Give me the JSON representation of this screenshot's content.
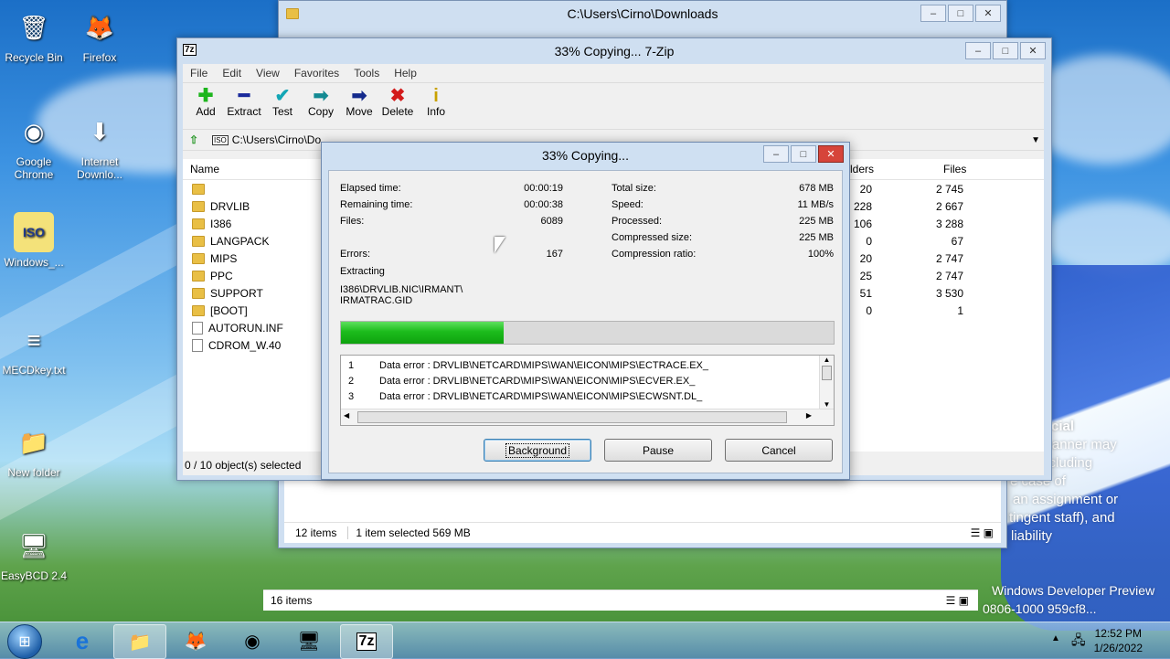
{
  "desktop": {
    "icons": [
      {
        "label": "Recycle Bin",
        "glyph": "🗑",
        "icon": "recycle-bin-icon"
      },
      {
        "label": "Firefox",
        "glyph": "🦊",
        "icon": "firefox-icon"
      },
      {
        "label": "Google Chrome",
        "glyph": "◉",
        "icon": "chrome-icon"
      },
      {
        "label": "Internet Downlo...",
        "glyph": "⬇",
        "icon": "idm-icon"
      },
      {
        "label": "Windows_...",
        "glyph": "ISO",
        "icon": "iso-file-icon"
      },
      {
        "label": "MECDkey.txt",
        "glyph": "≡",
        "icon": "text-file-icon"
      },
      {
        "label": "New folder",
        "glyph": "📁",
        "icon": "folder-icon"
      },
      {
        "label": "EasyBCD 2.4",
        "glyph": "🖥",
        "icon": "easybcd-icon"
      }
    ],
    "watermark_lines": [
      "cial",
      "any manner may",
      "nd including",
      "e case of",
      "an assignment or",
      "tingent staff), and",
      "liability"
    ],
    "build_text": [
      "Windows Developer Preview",
      "0806-1000 959cf8..."
    ]
  },
  "explorer": {
    "title": "C:\\Users\\Cirno\\Downloads",
    "status_items": "12 items",
    "status_selected": "1 item selected  569 MB",
    "status_items2": "16 items"
  },
  "sevenzip": {
    "title": "33% Copying... 7-Zip",
    "menu": [
      "File",
      "Edit",
      "View",
      "Favorites",
      "Tools",
      "Help"
    ],
    "toolbar": [
      {
        "label": "Add",
        "glyph": "✚",
        "color": "#1db51d",
        "icon": "add-icon"
      },
      {
        "label": "Extract",
        "glyph": "━",
        "color": "#1a2a9c",
        "icon": "extract-icon"
      },
      {
        "label": "Test",
        "glyph": "✔",
        "color": "#13a6b5",
        "icon": "test-icon"
      },
      {
        "label": "Copy",
        "glyph": "➡",
        "color": "#138a93",
        "icon": "copy-icon"
      },
      {
        "label": "Move",
        "glyph": "➡",
        "color": "#142a8c",
        "icon": "move-icon"
      },
      {
        "label": "Delete",
        "glyph": "✖",
        "color": "#d31b1b",
        "icon": "delete-icon"
      },
      {
        "label": "Info",
        "glyph": "i",
        "color": "#c8a100",
        "icon": "info-icon"
      }
    ],
    "address": "C:\\Users\\Cirno\\Do",
    "col_name": "Name",
    "col_folders": "lders",
    "col_files": "Files",
    "rows": [
      {
        "name": "",
        "folders": "20",
        "files": "2 745",
        "type": "folder"
      },
      {
        "name": "DRVLIB",
        "folders": "228",
        "files": "2 667",
        "type": "folder"
      },
      {
        "name": "I386",
        "folders": "106",
        "files": "3 288",
        "type": "folder"
      },
      {
        "name": "LANGPACK",
        "folders": "0",
        "files": "67",
        "type": "folder"
      },
      {
        "name": "MIPS",
        "folders": "20",
        "files": "2 747",
        "type": "folder"
      },
      {
        "name": "PPC",
        "folders": "25",
        "files": "2 747",
        "type": "folder"
      },
      {
        "name": "SUPPORT",
        "folders": "51",
        "files": "3 530",
        "type": "folder"
      },
      {
        "name": "[BOOT]",
        "folders": "0",
        "files": "1",
        "type": "folder"
      },
      {
        "name": "AUTORUN.INF",
        "folders": "",
        "files": "",
        "type": "file"
      },
      {
        "name": "CDROM_W.40",
        "folders": "",
        "files": "",
        "type": "file"
      }
    ],
    "status": "0 / 10 object(s) selected"
  },
  "dialog": {
    "title": "33% Copying...",
    "elapsed_label": "Elapsed time:",
    "elapsed": "00:00:19",
    "remaining_label": "Remaining time:",
    "remaining": "00:00:38",
    "files_label": "Files:",
    "files": "6089",
    "errors_label": "Errors:",
    "errors": "167",
    "total_label": "Total size:",
    "total": "678 MB",
    "speed_label": "Speed:",
    "speed": "11 MB/s",
    "processed_label": "Processed:",
    "processed": "225 MB",
    "compressed_label": "Compressed size:",
    "compressed": "225 MB",
    "ratio_label": "Compression ratio:",
    "ratio": "100%",
    "action": "Extracting",
    "current_file_1": "I386\\DRVLIB.NIC\\IRMANT\\",
    "current_file_2": "IRMATRAC.GID",
    "progress": 0.33,
    "errors_list": [
      {
        "n": "1",
        "text": "Data error : DRVLIB\\NETCARD\\MIPS\\WAN\\EICON\\MIPS\\ECTRACE.EX_"
      },
      {
        "n": "2",
        "text": "Data error : DRVLIB\\NETCARD\\MIPS\\WAN\\EICON\\MIPS\\ECVER.EX_"
      },
      {
        "n": "3",
        "text": "Data error : DRVLIB\\NETCARD\\MIPS\\WAN\\EICON\\MIPS\\ECWSNT.DL_"
      }
    ],
    "btn_background": "Background",
    "btn_pause": "Pause",
    "btn_cancel": "Cancel"
  },
  "taskbar": {
    "time": "12:52 PM",
    "date": "1/26/2022",
    "apps": [
      {
        "glyph": "e",
        "icon": "ie-icon",
        "active": false
      },
      {
        "glyph": "📁",
        "icon": "explorer-icon",
        "active": true
      },
      {
        "glyph": "🦊",
        "icon": "firefox-icon",
        "active": false
      },
      {
        "glyph": "◉",
        "icon": "chrome-icon",
        "active": false
      },
      {
        "glyph": "🖥",
        "icon": "easybcd-icon",
        "active": false
      },
      {
        "glyph": "7z",
        "icon": "sevenzip-icon",
        "active": true
      }
    ]
  }
}
